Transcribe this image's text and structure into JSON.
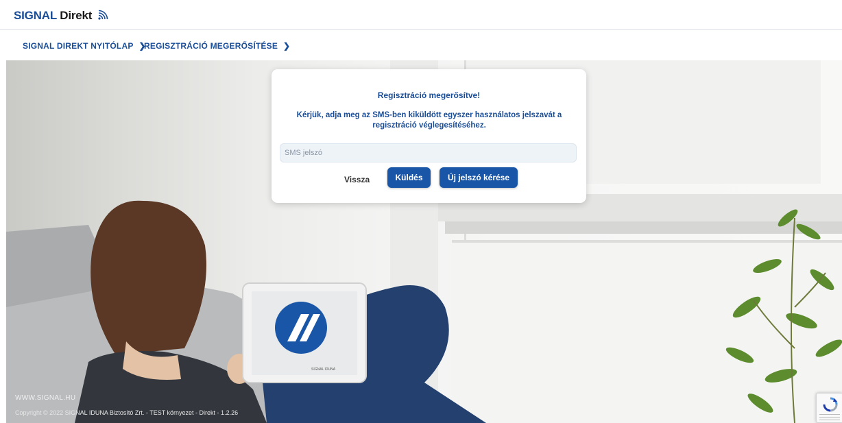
{
  "header": {
    "logo_brand": "SIGNAL",
    "logo_suffix": "Direkt"
  },
  "breadcrumb": {
    "items": [
      {
        "label": "SIGNAL DIREKT NYITÓLAP"
      },
      {
        "label": "REGISZTRÁCIÓ MEGERŐSÍTÉSE"
      }
    ]
  },
  "dialog": {
    "title": "Regisztráció megerősítve!",
    "message": "Kérjük, adja meg az SMS-ben kiküldött egyszer használatos jelszavát a regisztráció véglegesítéséhez.",
    "sms_input": {
      "placeholder": "SMS jelszó",
      "value": ""
    },
    "back_label": "Vissza",
    "send_label": "Küldés",
    "new_password_label": "Új jelszó kérése"
  },
  "hero": {
    "tablet_brand_text": "SIGNAL IDUNA"
  },
  "footer": {
    "url": "WWW.SIGNAL.HU",
    "copyright": "Copyright © 2022 SIGNAL IDUNA Biztosító Zrt. - TEST környezet - Direkt - 1.2.26"
  },
  "colors": {
    "brand_blue": "#1a4d97",
    "button_blue": "#1a56a8"
  },
  "icons": {
    "logo_signal": "wifi-signal-icon",
    "breadcrumb_separator": "chevron-right-icon",
    "recaptcha": "recaptcha-icon"
  }
}
